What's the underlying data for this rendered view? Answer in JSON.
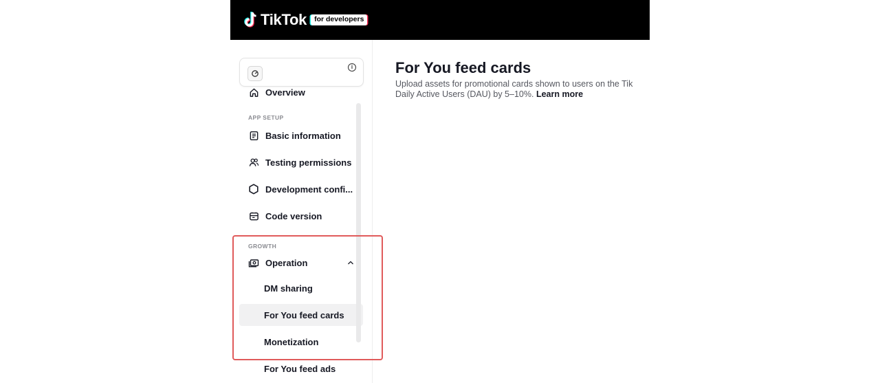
{
  "header": {
    "logo_text": "TikTok",
    "badge_text": "for developers"
  },
  "app_card": {
    "icon": "app-cube-icon",
    "info_icon": "info-icon"
  },
  "sidebar": {
    "overview": "Overview",
    "app_setup_label": "APP SETUP",
    "basic_information": "Basic information",
    "testing_permissions": "Testing permissions",
    "development_config": "Development confi...",
    "code_version": "Code version",
    "growth_label": "GROWTH",
    "operation": "Operation",
    "dm_sharing": "DM sharing",
    "for_you_feed_cards": "For You feed cards",
    "monetization": "Monetization",
    "for_you_feed_ads": "For You feed ads"
  },
  "main": {
    "title": "For You feed cards",
    "description_line1": "Upload assets for promotional cards shown to users on the Tik",
    "description_line2": "Daily Active Users (DAU) by 5–10%.",
    "learn_more": "Learn more"
  },
  "colors": {
    "topbar": "#000000",
    "highlight": "#e05a5a",
    "active_bg": "#f1f1f2"
  }
}
